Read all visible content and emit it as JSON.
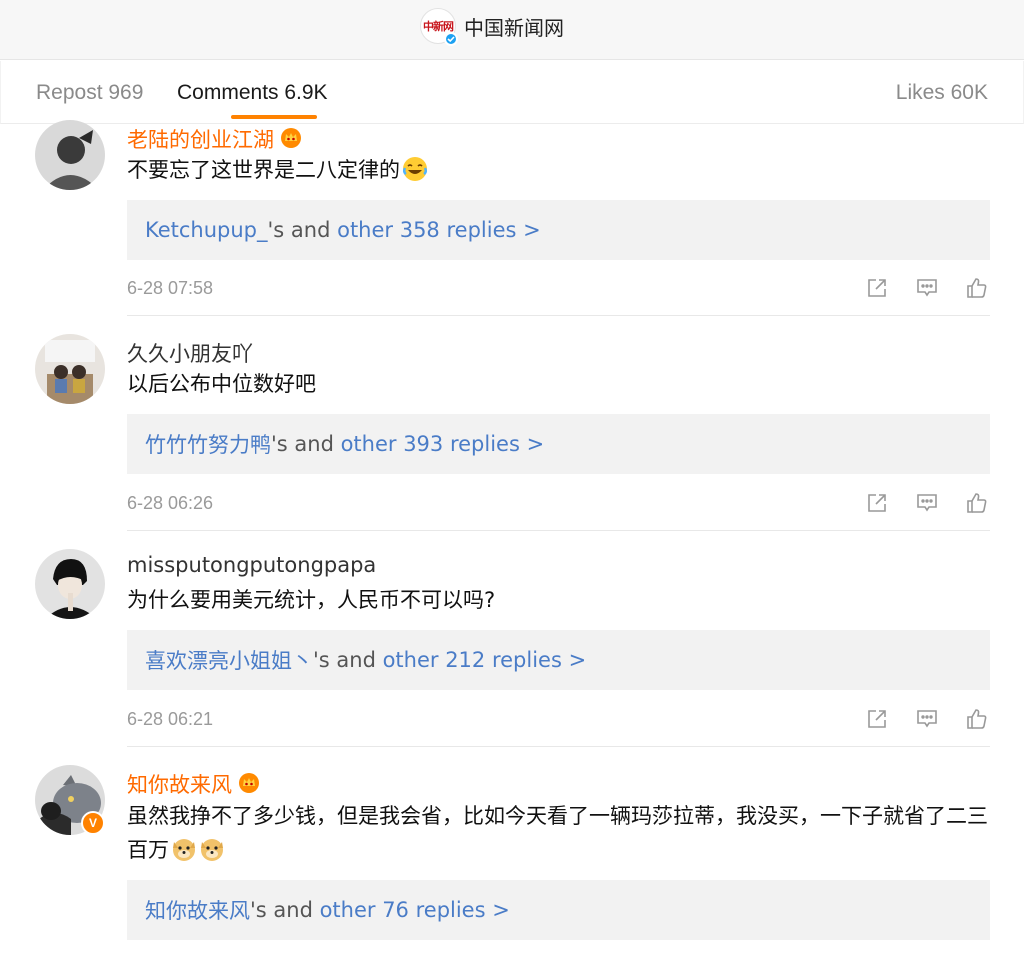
{
  "header": {
    "account_name": "中国新闻网",
    "logo_label": "中新网"
  },
  "tabs": {
    "repost": "Repost 969",
    "comments": "Comments 6.9K",
    "likes": "Likes 60K"
  },
  "colors": {
    "accent": "#ff8200",
    "link": "#4a7cc7",
    "vip_name": "#ff6a00"
  },
  "comments": [
    {
      "username": "老陆的创业江湖",
      "vip": true,
      "text": "不要忘了这世界是二八定律的",
      "emoji": "laughing-tears",
      "reply_user": "Ketchupup_",
      "reply_mid": "'s and ",
      "reply_tail": "other 358 replies >",
      "time": "6-28 07:58"
    },
    {
      "username": "久久小朋友吖",
      "vip": false,
      "text": "以后公布中位数好吧",
      "reply_user": "竹竹竹努力鸭",
      "reply_mid": "'s and ",
      "reply_tail": "other 393 replies >",
      "time": "6-28 06:26"
    },
    {
      "username": "missputongputongpapa",
      "vip": false,
      "text": "为什么要用美元统计，人民币不可以吗?",
      "reply_user": "喜欢漂亮小姐姐丶",
      "reply_mid": "'s and ",
      "reply_tail": "other 212 replies >",
      "time": "6-28 06:21"
    },
    {
      "username": "知你故来风",
      "vip": true,
      "text": "虽然我挣不了多少钱，但是我会省，比如今天看了一辆玛莎拉蒂，我没买，一下子就省了二三百万",
      "emoji": "doge",
      "reply_user": "知你故来风",
      "reply_mid": "'s and ",
      "reply_tail": "other 76 replies >",
      "time": ""
    }
  ]
}
